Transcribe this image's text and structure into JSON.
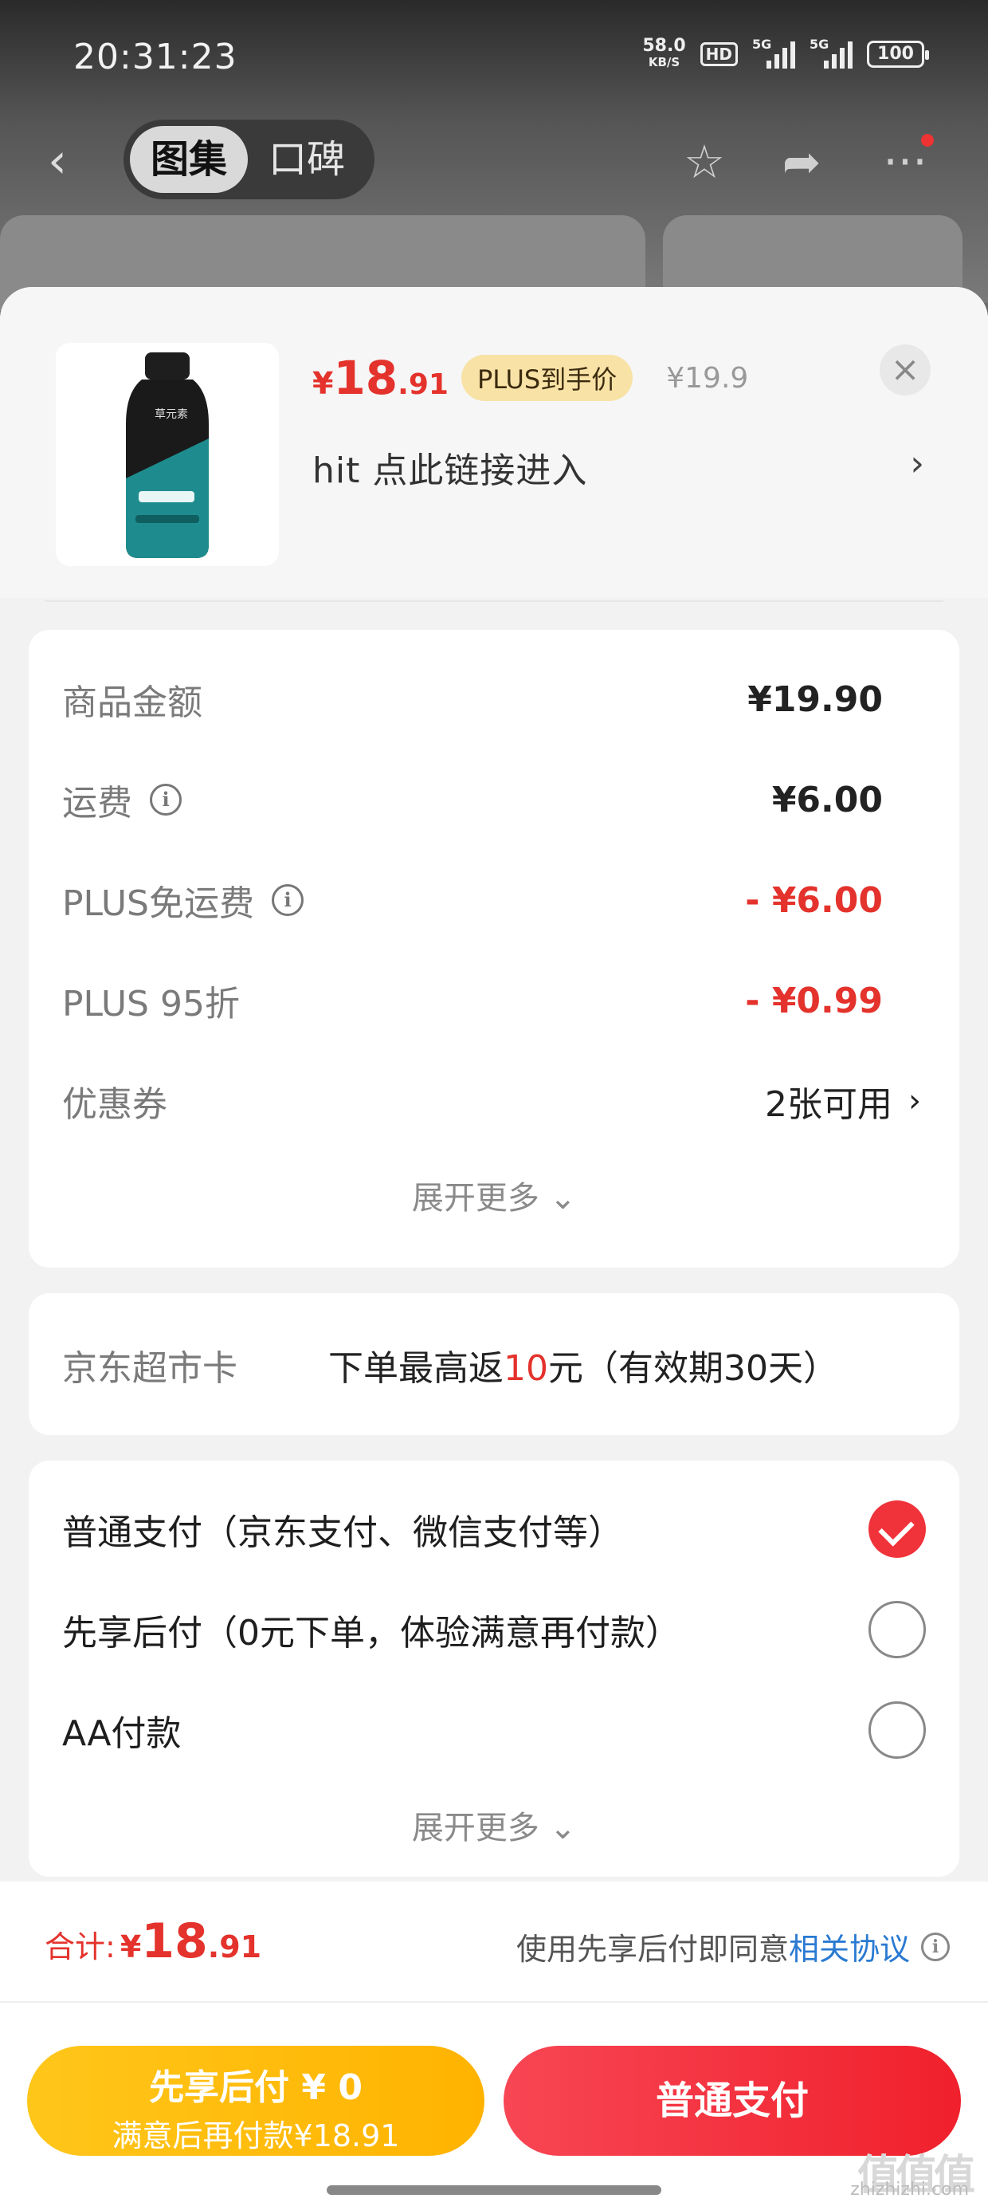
{
  "status_bar": {
    "time": "20:31:23",
    "net_speed": "58.0",
    "net_unit": "KB/S",
    "hd": "HD",
    "signal1": "5G",
    "signal2": "5G",
    "battery": "100"
  },
  "nav": {
    "tabs": [
      "图集",
      "口碑"
    ],
    "active_tab": 0,
    "icons": [
      "back-icon",
      "star-icon",
      "share-icon",
      "more-icon"
    ]
  },
  "product": {
    "price_currency": "¥",
    "price_int": "18",
    "price_dec": ".91",
    "plus_tag": "PLUS到手价",
    "original_price": "¥19.9",
    "title": "hit  点此链接进入",
    "chevron": "›",
    "close": "×"
  },
  "costs": {
    "rows": [
      {
        "label": "商品金额",
        "value": "¥19.90",
        "info": false,
        "red": false
      },
      {
        "label": "运费",
        "value": "¥6.00",
        "info": true,
        "red": false
      },
      {
        "label": "PLUS免运费",
        "value": "- ¥6.00",
        "info": true,
        "red": true
      },
      {
        "label": "PLUS 95折",
        "value": "- ¥0.99",
        "info": false,
        "red": true
      }
    ],
    "coupon_label": "优惠券",
    "coupon_value": "2张可用",
    "expand": "展开更多 ⌄"
  },
  "jd_card": {
    "label": "京东超市卡",
    "text_pre": "下单最高返",
    "text_num": "10",
    "text_post": "元（有效期30天）"
  },
  "payment": {
    "options": [
      {
        "label": "普通支付（京东支付、微信支付等）",
        "checked": true
      },
      {
        "label": "先享后付（0元下单，体验满意再付款）",
        "checked": false
      },
      {
        "label": "AA付款",
        "checked": false
      }
    ],
    "expand": "展开更多 ⌄"
  },
  "footer": {
    "total_label": "合计:",
    "total_currency": "¥",
    "total_int": "18",
    "total_dec": ".91",
    "agree_text": "使用先享后付即同意",
    "agree_link": "相关协议",
    "btn_later_l1": "先享后付 ¥ 0",
    "btn_later_l2": "满意后再付款¥18.91",
    "btn_pay": "普通支付"
  },
  "watermark": {
    "brand": "值值值",
    "url": "zhizhizhi.com"
  },
  "colors": {
    "accent_red": "#e4322c",
    "plus_gold": "#f8e2a6",
    "btn_yellow": "#ffb300",
    "link_blue": "#2a7ad2"
  }
}
